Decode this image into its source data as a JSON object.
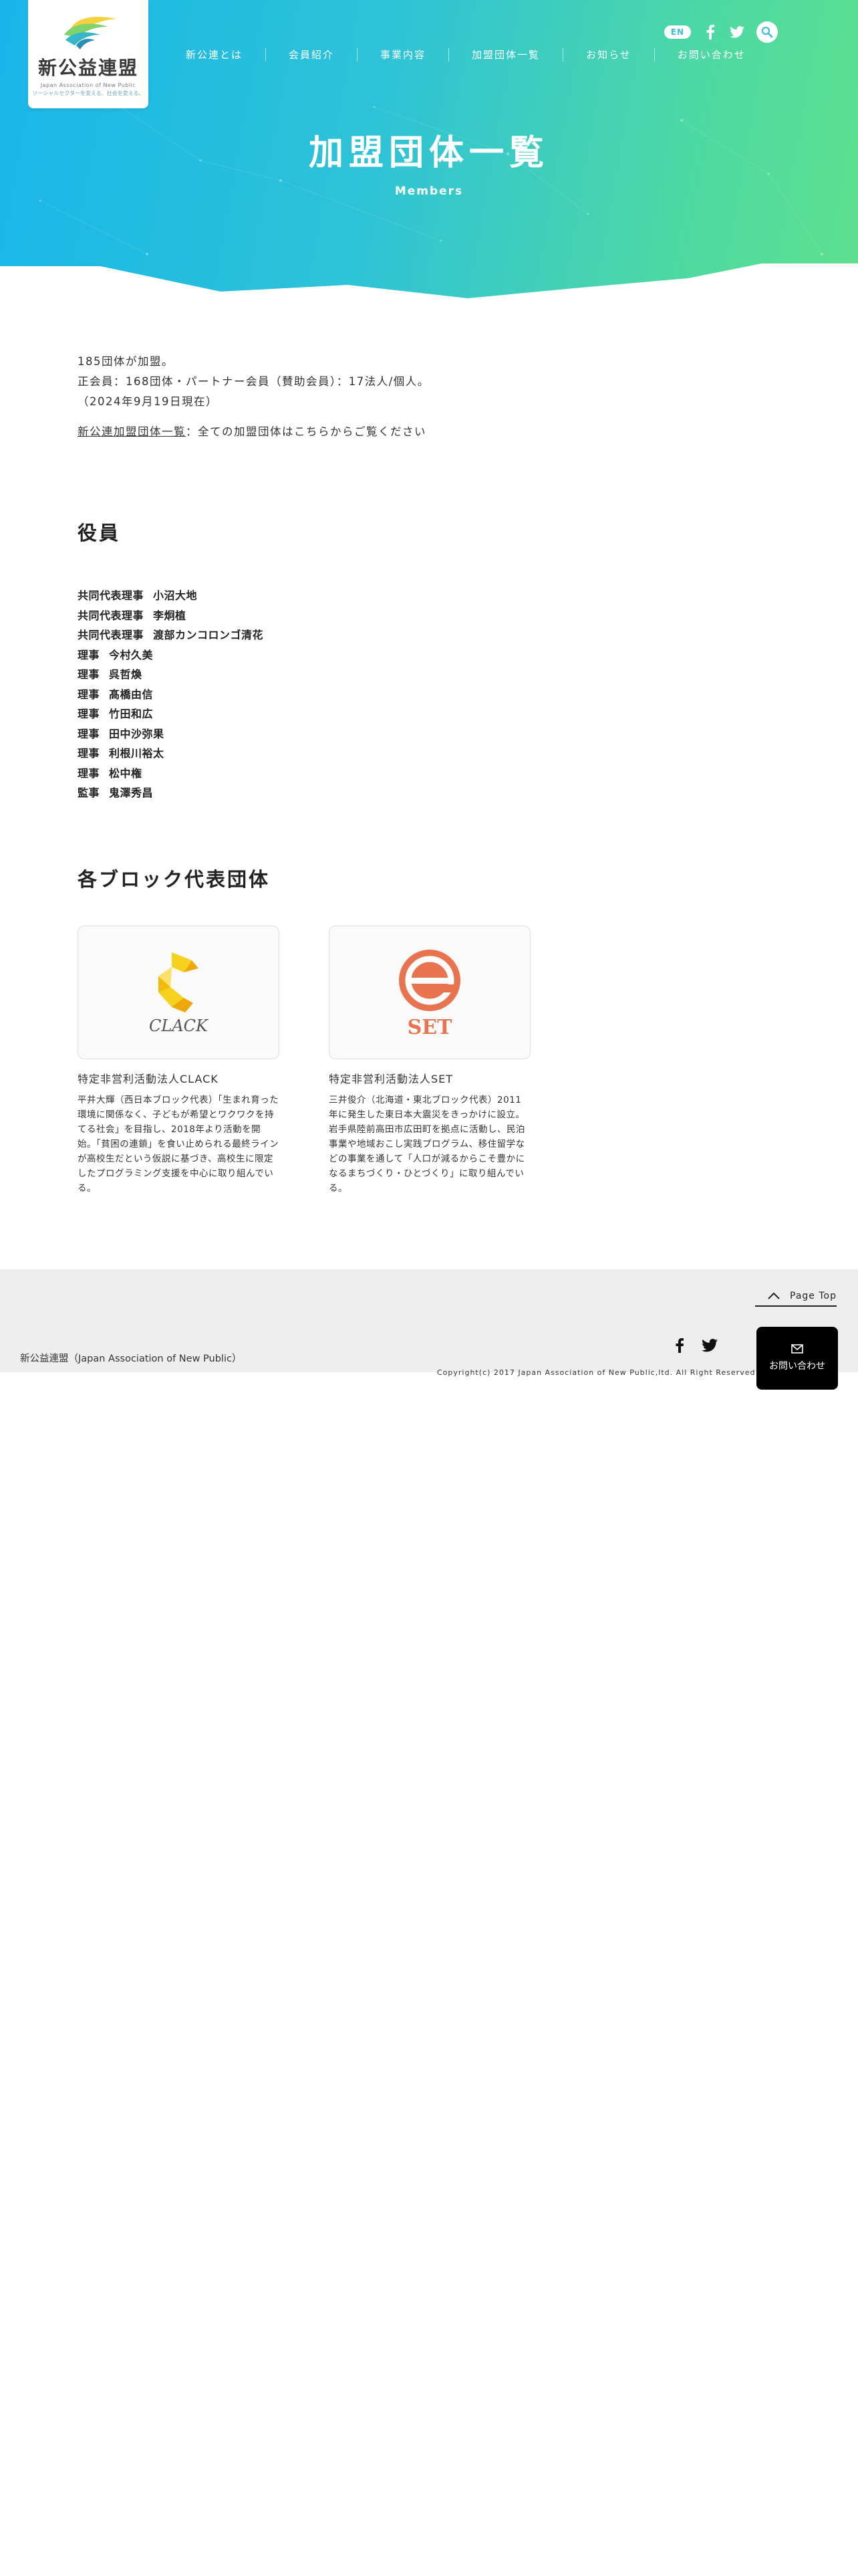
{
  "header": {
    "logo": {
      "name": "新公益連盟",
      "sub_en": "Japan Association of New Public",
      "tagline": "ソーシャルセクターを変える、社会を変える。"
    },
    "lang_label": "EN",
    "icons": [
      "facebook-icon",
      "twitter-icon",
      "search-icon"
    ],
    "nav": [
      {
        "label": "新公連とは"
      },
      {
        "label": "会員紹介"
      },
      {
        "label": "事業内容"
      },
      {
        "label": "加盟団体一覧"
      },
      {
        "label": "お知らせ"
      },
      {
        "label": "お問い合わせ"
      }
    ],
    "colors": {
      "gradient_start": "#19b6ea",
      "gradient_end": "#5ee08e"
    }
  },
  "hero": {
    "title": "加盟団体一覧",
    "subtitle": "Members"
  },
  "intro": {
    "lines": [
      "185団体が加盟。",
      "正会員：168団体・パートナー会員（賛助会員）：17法人/個人。",
      "（2024年9月19日現在）"
    ],
    "link_text": "新公連加盟団体一覧",
    "link_suffix": "：全ての加盟団体はこちらからご覧ください"
  },
  "officers": {
    "title": "役員",
    "list": [
      {
        "role": "共同代表理事",
        "name": "小沼大地"
      },
      {
        "role": "共同代表理事",
        "name": "李炯植"
      },
      {
        "role": "共同代表理事",
        "name": "渡部カンコロンゴ清花"
      },
      {
        "role": "理事",
        "name": "今村久美"
      },
      {
        "role": "理事",
        "name": "呉哲煥"
      },
      {
        "role": "理事",
        "name": "髙橋由信"
      },
      {
        "role": "理事",
        "name": "竹田和広"
      },
      {
        "role": "理事",
        "name": "田中沙弥果"
      },
      {
        "role": "理事",
        "name": "利根川裕太"
      },
      {
        "role": "理事",
        "name": "松中権"
      },
      {
        "role": "監事",
        "name": "鬼澤秀昌"
      }
    ]
  },
  "blocks": {
    "title": "各ブロック代表団体",
    "cards": [
      {
        "logo_text": "CLACK",
        "logo_icon": "clack-logo",
        "name": "特定非営利活動法人CLACK",
        "desc": "平井大輝（西日本ブロック代表）「生まれ育った環境に関係なく、子どもが希望とワクワクを持てる社会」を目指し、2018年より活動を開始。「貧困の連鎖」を食い止められる最終ラインが高校生だという仮説に基づき、高校生に限定したプログラミング支援を中心に取り組んでいる。"
      },
      {
        "logo_text": "SET",
        "logo_icon": "set-logo",
        "name": "特定非営利活動法人SET",
        "desc": "三井俊介（北海道・東北ブロック代表）2011 年に発生した東日本大震災をきっかけに設立。岩手県陸前高田市広田町を拠点に活動し、民泊事業や地域おこし実践プログラム、移住留学などの事業を通して「人口が減るからこそ豊かになるまちづくり・ひとづくり」に取り組んでいる。"
      }
    ]
  },
  "footer": {
    "org_name": "新公益連盟（Japan Association of New Public）",
    "page_top": "Page Top",
    "copyright": "Copyright(c) 2017 Japan Association of New Public,ltd. All Right Reserved",
    "contact_label": "お問い合わせ"
  }
}
